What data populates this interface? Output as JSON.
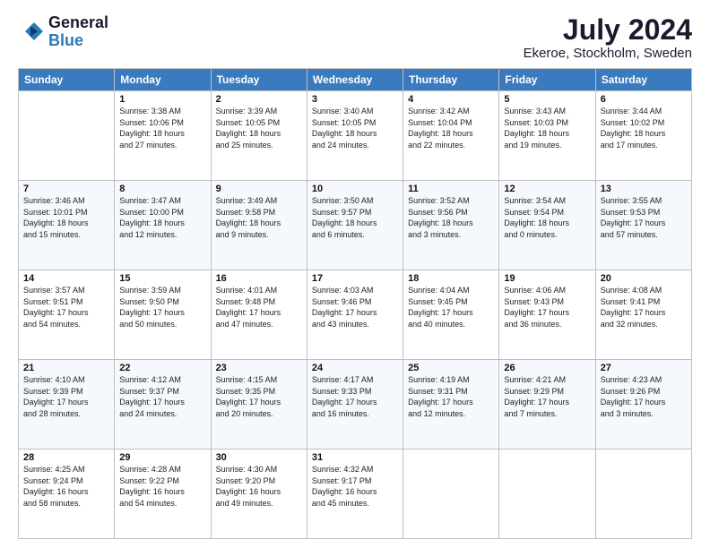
{
  "logo": {
    "line1": "General",
    "line2": "Blue"
  },
  "title": "July 2024",
  "subtitle": "Ekeroe, Stockholm, Sweden",
  "columns": [
    "Sunday",
    "Monday",
    "Tuesday",
    "Wednesday",
    "Thursday",
    "Friday",
    "Saturday"
  ],
  "weeks": [
    [
      {
        "day": "",
        "sunrise": "",
        "sunset": "",
        "daylight": ""
      },
      {
        "day": "1",
        "sunrise": "3:38 AM",
        "sunset": "10:06 PM",
        "daylight": "18 hours and 27 minutes."
      },
      {
        "day": "2",
        "sunrise": "3:39 AM",
        "sunset": "10:05 PM",
        "daylight": "18 hours and 25 minutes."
      },
      {
        "day": "3",
        "sunrise": "3:40 AM",
        "sunset": "10:05 PM",
        "daylight": "18 hours and 24 minutes."
      },
      {
        "day": "4",
        "sunrise": "3:42 AM",
        "sunset": "10:04 PM",
        "daylight": "18 hours and 22 minutes."
      },
      {
        "day": "5",
        "sunrise": "3:43 AM",
        "sunset": "10:03 PM",
        "daylight": "18 hours and 19 minutes."
      },
      {
        "day": "6",
        "sunrise": "3:44 AM",
        "sunset": "10:02 PM",
        "daylight": "18 hours and 17 minutes."
      }
    ],
    [
      {
        "day": "7",
        "sunrise": "3:46 AM",
        "sunset": "10:01 PM",
        "daylight": "18 hours and 15 minutes."
      },
      {
        "day": "8",
        "sunrise": "3:47 AM",
        "sunset": "10:00 PM",
        "daylight": "18 hours and 12 minutes."
      },
      {
        "day": "9",
        "sunrise": "3:49 AM",
        "sunset": "9:58 PM",
        "daylight": "18 hours and 9 minutes."
      },
      {
        "day": "10",
        "sunrise": "3:50 AM",
        "sunset": "9:57 PM",
        "daylight": "18 hours and 6 minutes."
      },
      {
        "day": "11",
        "sunrise": "3:52 AM",
        "sunset": "9:56 PM",
        "daylight": "18 hours and 3 minutes."
      },
      {
        "day": "12",
        "sunrise": "3:54 AM",
        "sunset": "9:54 PM",
        "daylight": "18 hours and 0 minutes."
      },
      {
        "day": "13",
        "sunrise": "3:55 AM",
        "sunset": "9:53 PM",
        "daylight": "17 hours and 57 minutes."
      }
    ],
    [
      {
        "day": "14",
        "sunrise": "3:57 AM",
        "sunset": "9:51 PM",
        "daylight": "17 hours and 54 minutes."
      },
      {
        "day": "15",
        "sunrise": "3:59 AM",
        "sunset": "9:50 PM",
        "daylight": "17 hours and 50 minutes."
      },
      {
        "day": "16",
        "sunrise": "4:01 AM",
        "sunset": "9:48 PM",
        "daylight": "17 hours and 47 minutes."
      },
      {
        "day": "17",
        "sunrise": "4:03 AM",
        "sunset": "9:46 PM",
        "daylight": "17 hours and 43 minutes."
      },
      {
        "day": "18",
        "sunrise": "4:04 AM",
        "sunset": "9:45 PM",
        "daylight": "17 hours and 40 minutes."
      },
      {
        "day": "19",
        "sunrise": "4:06 AM",
        "sunset": "9:43 PM",
        "daylight": "17 hours and 36 minutes."
      },
      {
        "day": "20",
        "sunrise": "4:08 AM",
        "sunset": "9:41 PM",
        "daylight": "17 hours and 32 minutes."
      }
    ],
    [
      {
        "day": "21",
        "sunrise": "4:10 AM",
        "sunset": "9:39 PM",
        "daylight": "17 hours and 28 minutes."
      },
      {
        "day": "22",
        "sunrise": "4:12 AM",
        "sunset": "9:37 PM",
        "daylight": "17 hours and 24 minutes."
      },
      {
        "day": "23",
        "sunrise": "4:15 AM",
        "sunset": "9:35 PM",
        "daylight": "17 hours and 20 minutes."
      },
      {
        "day": "24",
        "sunrise": "4:17 AM",
        "sunset": "9:33 PM",
        "daylight": "17 hours and 16 minutes."
      },
      {
        "day": "25",
        "sunrise": "4:19 AM",
        "sunset": "9:31 PM",
        "daylight": "17 hours and 12 minutes."
      },
      {
        "day": "26",
        "sunrise": "4:21 AM",
        "sunset": "9:29 PM",
        "daylight": "17 hours and 7 minutes."
      },
      {
        "day": "27",
        "sunrise": "4:23 AM",
        "sunset": "9:26 PM",
        "daylight": "17 hours and 3 minutes."
      }
    ],
    [
      {
        "day": "28",
        "sunrise": "4:25 AM",
        "sunset": "9:24 PM",
        "daylight": "16 hours and 58 minutes."
      },
      {
        "day": "29",
        "sunrise": "4:28 AM",
        "sunset": "9:22 PM",
        "daylight": "16 hours and 54 minutes."
      },
      {
        "day": "30",
        "sunrise": "4:30 AM",
        "sunset": "9:20 PM",
        "daylight": "16 hours and 49 minutes."
      },
      {
        "day": "31",
        "sunrise": "4:32 AM",
        "sunset": "9:17 PM",
        "daylight": "16 hours and 45 minutes."
      },
      {
        "day": "",
        "sunrise": "",
        "sunset": "",
        "daylight": ""
      },
      {
        "day": "",
        "sunrise": "",
        "sunset": "",
        "daylight": ""
      },
      {
        "day": "",
        "sunrise": "",
        "sunset": "",
        "daylight": ""
      }
    ]
  ]
}
